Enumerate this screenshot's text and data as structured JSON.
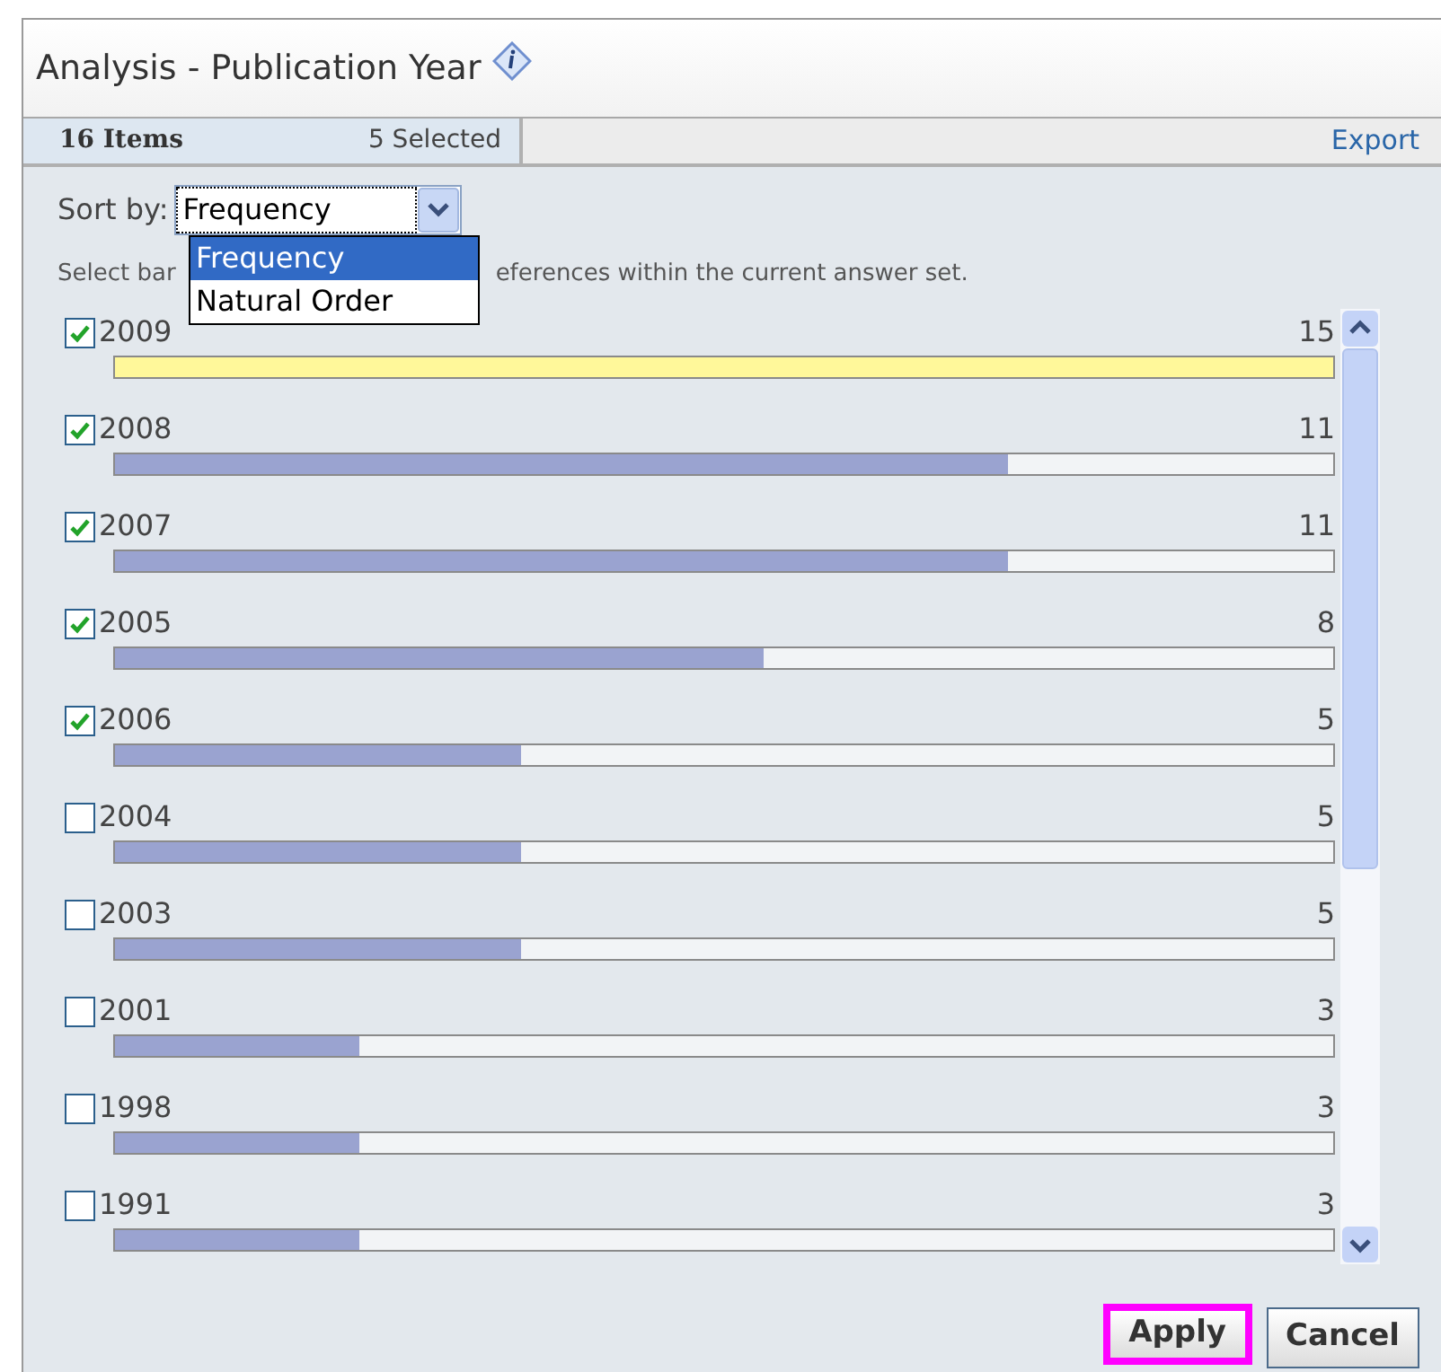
{
  "title": "Analysis - Publication Year",
  "header": {
    "items": "16 Items",
    "selected": "5 Selected",
    "export": "Export"
  },
  "sort": {
    "label": "Sort by:",
    "value": "Frequency",
    "expanded": true,
    "options": [
      {
        "label": "Frequency",
        "selected": true
      },
      {
        "label": "Natural Order",
        "selected": false
      }
    ]
  },
  "hint": [
    "Select bar",
    "eferences within the current answer set."
  ],
  "rows": [
    {
      "label": "2009",
      "count": "15",
      "checked": true,
      "highlighted": true,
      "level": 1
    },
    {
      "label": "2008",
      "count": "11",
      "checked": true,
      "highlighted": false,
      "level": 0.733
    },
    {
      "label": "2007",
      "count": "11",
      "checked": true,
      "highlighted": false,
      "level": 0.733
    },
    {
      "label": "2005",
      "count": "8",
      "checked": true,
      "highlighted": false,
      "level": 0.533
    },
    {
      "label": "2006",
      "count": "5",
      "checked": true,
      "highlighted": false,
      "level": 0.333
    },
    {
      "label": "2004",
      "count": "5",
      "checked": false,
      "highlighted": false,
      "level": 0.333
    },
    {
      "label": "2003",
      "count": "5",
      "checked": false,
      "highlighted": false,
      "level": 0.333
    },
    {
      "label": "2001",
      "count": "3",
      "checked": false,
      "highlighted": false,
      "level": 0.2
    },
    {
      "label": "1998",
      "count": "3",
      "checked": false,
      "highlighted": false,
      "level": 0.2
    },
    {
      "label": "1991",
      "count": "3",
      "checked": false,
      "highlighted": false,
      "level": 0.2
    }
  ],
  "buttons": [
    {
      "label": "Apply",
      "highlighted": true
    },
    {
      "label": "Cancel",
      "highlighted": false
    }
  ]
}
